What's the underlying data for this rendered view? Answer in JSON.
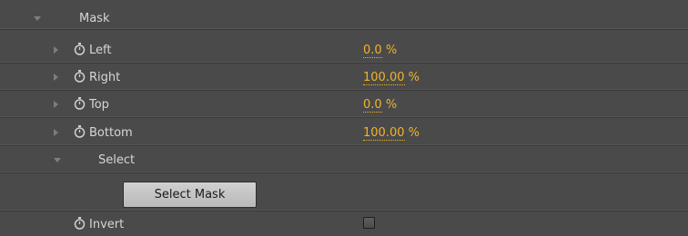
{
  "section": {
    "title": "Mask"
  },
  "properties": [
    {
      "label": "Left",
      "value": "0.0",
      "unit": " %"
    },
    {
      "label": "Right",
      "value": "100.00",
      "unit": " %"
    },
    {
      "label": "Top",
      "value": "0.0",
      "unit": " %"
    },
    {
      "label": "Bottom",
      "value": "100.00",
      "unit": " %"
    }
  ],
  "select_group": {
    "label": "Select",
    "button_label": "Select Mask"
  },
  "invert": {
    "label": "Invert",
    "checked": false
  },
  "colors": {
    "panel_bg": "#4a4a4a",
    "value_accent": "#f0b428",
    "label_text": "#d6d6d6"
  },
  "icons": [
    "disclosure-triangle-icon",
    "stopwatch-icon"
  ]
}
